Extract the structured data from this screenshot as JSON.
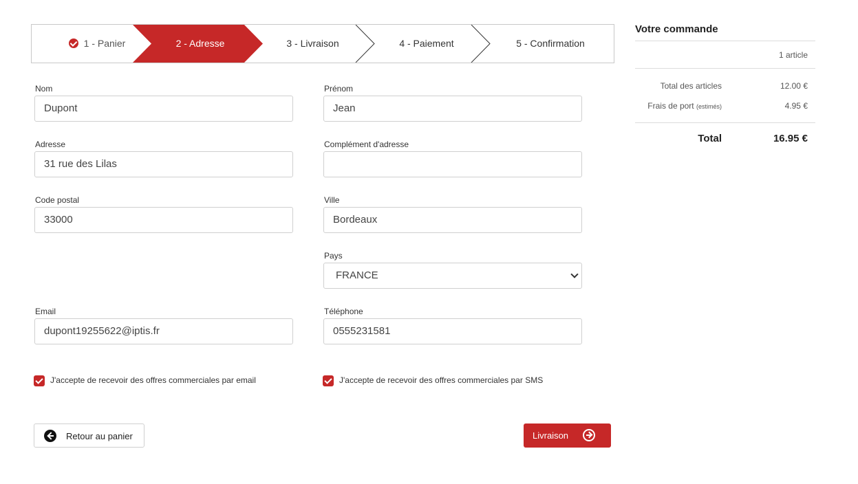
{
  "colors": {
    "accent": "#c62828",
    "border": "#c8c8c8",
    "text": "#333333"
  },
  "stepper": {
    "steps": [
      {
        "label": "1 - Panier",
        "state": "done",
        "icon": "check-circle-icon"
      },
      {
        "label": "2 - Adresse",
        "state": "active"
      },
      {
        "label": "3 - Livraison",
        "state": "pending"
      },
      {
        "label": "4 - Paiement",
        "state": "pending"
      },
      {
        "label": "5 - Confirmation",
        "state": "pending"
      }
    ]
  },
  "form": {
    "nom": {
      "label": "Nom",
      "value": "Dupont"
    },
    "prenom": {
      "label": "Prénom",
      "value": "Jean"
    },
    "adresse": {
      "label": "Adresse",
      "value": "31 rue des Lilas"
    },
    "complement": {
      "label": "Complément d'adresse",
      "value": ""
    },
    "code_postal": {
      "label": "Code postal",
      "value": "33000"
    },
    "ville": {
      "label": "Ville",
      "value": "Bordeaux"
    },
    "pays": {
      "label": "Pays",
      "value": "FRANCE"
    },
    "email": {
      "label": "Email",
      "value": "dupont19255622@iptis.fr"
    },
    "telephone": {
      "label": "Téléphone",
      "value": "0555231581"
    },
    "optin_email": {
      "label": "J'accepte de recevoir des offres commerciales par email",
      "checked": true
    },
    "optin_sms": {
      "label": "J'accepte de recevoir des offres commerciales par SMS",
      "checked": true
    }
  },
  "buttons": {
    "back": {
      "label": "Retour au panier",
      "icon": "arrow-left-circle-icon"
    },
    "next": {
      "label": "Livraison",
      "icon": "arrow-right-circle-icon"
    }
  },
  "summary": {
    "title": "Votre commande",
    "count": "1 article",
    "items_label": "Total des articles",
    "items_value": "12.00 €",
    "shipping_label": "Frais de port",
    "shipping_note": "(estimés)",
    "shipping_value": "4.95 €",
    "total_label": "Total",
    "total_value": "16.95 €"
  }
}
